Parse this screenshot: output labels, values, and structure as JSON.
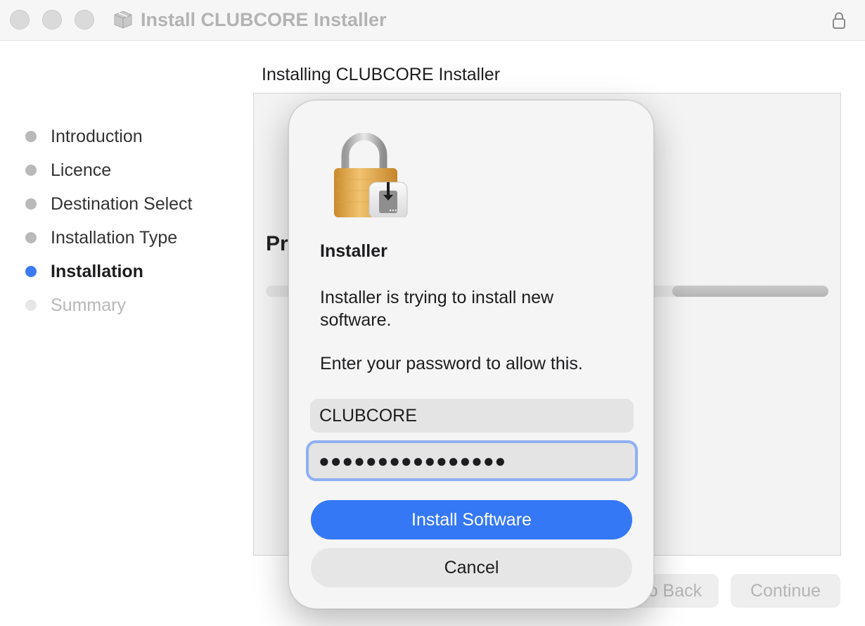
{
  "window": {
    "title": "Install CLUBCORE Installer"
  },
  "sidebar": {
    "steps": [
      {
        "label": "Introduction",
        "state": "done"
      },
      {
        "label": "Licence",
        "state": "done"
      },
      {
        "label": "Destination Select",
        "state": "done"
      },
      {
        "label": "Installation Type",
        "state": "done"
      },
      {
        "label": "Installation",
        "state": "active"
      },
      {
        "label": "Summary",
        "state": "pending"
      }
    ]
  },
  "main": {
    "heading": "Installing CLUBCORE Installer",
    "status_partial": "Pr",
    "progress_fraction": 0.28
  },
  "footer": {
    "back_label": "o Back",
    "continue_label": "Continue"
  },
  "dialog": {
    "title": "Installer",
    "message": "Installer is trying to install new software.",
    "prompt": "Enter your password to allow this.",
    "username_value": "CLUBCORE",
    "password_mask": "●●●●●●●●●●●●●●●●",
    "primary_label": "Install Software",
    "cancel_label": "Cancel"
  },
  "colors": {
    "accent": "#3478f6",
    "active_step_dot": "#3a7bf1",
    "focus_ring": "#8fb0f3"
  },
  "icons": {
    "titlebar": "package-icon",
    "titlebar_right": "lock-icon",
    "dialog": "padlock-installer-icon"
  }
}
